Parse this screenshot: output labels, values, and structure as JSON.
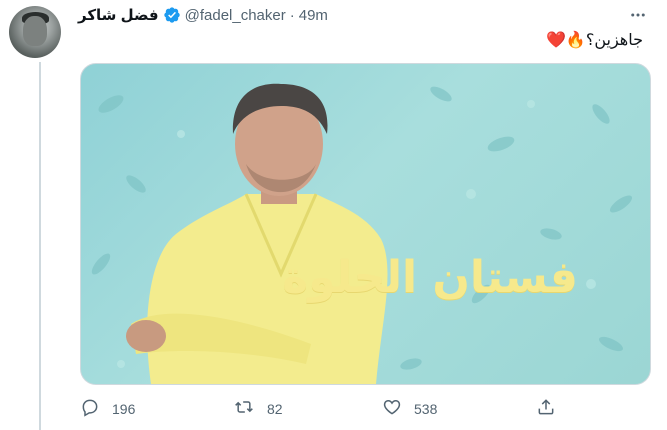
{
  "tweet": {
    "display_name": "فضل شاكر",
    "handle": "@fadel_chaker",
    "separator": "·",
    "time": "49m",
    "text": "جاهزين؟🔥❤️",
    "media": {
      "poster_text": "فستان الحلوة"
    },
    "stats": {
      "replies": "196",
      "retweets": "82",
      "likes": "538"
    }
  },
  "icons": {
    "verified": "verified-badge-icon",
    "more": "more-options-icon",
    "reply": "reply-icon",
    "retweet": "retweet-icon",
    "like": "heart-icon",
    "share": "share-icon"
  },
  "colors": {
    "accent": "#1d9bf0",
    "secondary_text": "#536471",
    "poster_background": "#9bd6d4",
    "poster_text": "#f6e98c"
  }
}
